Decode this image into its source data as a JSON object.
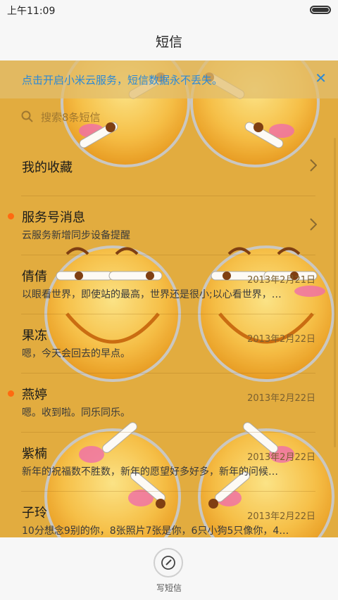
{
  "status": {
    "time": "上午11:09"
  },
  "header": {
    "title": "短信"
  },
  "banner": {
    "text": "点击开启小米云服务，短信数据永不丢失。",
    "close": "✕"
  },
  "search": {
    "placeholder": "搜索8条短信"
  },
  "items": [
    {
      "name": "我的收藏",
      "snippet": "",
      "date": "",
      "unread": false
    },
    {
      "name": "服务号消息",
      "snippet": "云服务新增同步设备提醒",
      "date": "",
      "unread": true
    },
    {
      "name": "倩倩",
      "snippet": "以眼看世界，即使站的最高，世界还是很小;以心看世界，…",
      "date": "2013年2月21日",
      "unread": false
    },
    {
      "name": "果冻",
      "snippet": "嗯，今天会回去的早点。",
      "date": "2013年2月22日",
      "unread": false
    },
    {
      "name": "燕婷",
      "snippet": "嗯。收到啦。同乐同乐。",
      "date": "2013年2月22日",
      "unread": true
    },
    {
      "name": "紫楠",
      "snippet": "新年的祝福数不胜数，新年的愿望好多好多，新年的问候…",
      "date": "2013年2月22日",
      "unread": false
    },
    {
      "name": "子玲",
      "snippet": "10分想念9别的你，8张照片7张是你，6只小狗5只像你，4…",
      "date": "2013年2月22日",
      "unread": false
    }
  ],
  "compose": {
    "label": "写短信",
    "icon": "pencil-circle-icon"
  },
  "colors": {
    "accent": "#2b89d6",
    "unread_dot": "#ff6a10",
    "wallpaper": "#e2ac3f"
  }
}
